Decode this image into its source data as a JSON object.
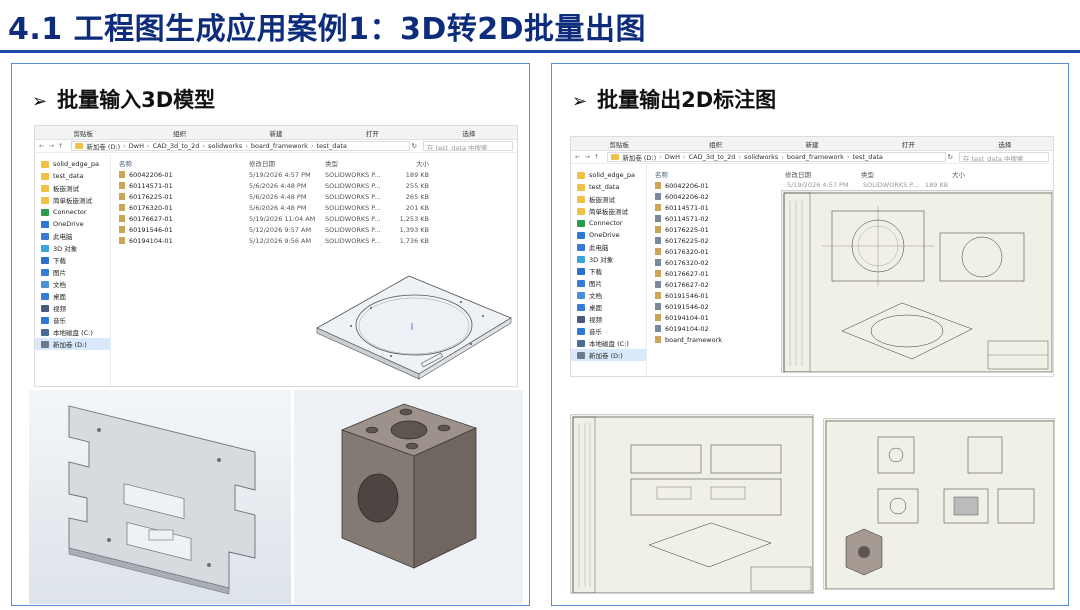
{
  "slide": {
    "title": "4.1 工程图生成应用案例1：3D转2D批量出图"
  },
  "left_panel": {
    "bullet": "➢",
    "heading": "批量输入3D模型",
    "explorer": {
      "ribbon": [
        "剪贴板",
        "组织",
        "新建",
        "打开",
        "选择"
      ],
      "address": [
        "新加卷 (D:)",
        "DwH",
        "CAD_3d_to_2d",
        "solidworks",
        "board_framework",
        "test_data"
      ],
      "search_placeholder": "在 test_data 中搜索",
      "nav_items": [
        "solid_edge_pa",
        "test_data",
        "板嵌测试",
        "简单板嵌测试",
        "Connector",
        "OneDrive",
        "此电脑",
        "3D 对象",
        "下载",
        "图片",
        "文档",
        "桌面",
        "视频",
        "音乐",
        "本地磁盘 (C:)",
        "新加卷 (D:)"
      ],
      "columns": [
        "名称",
        "修改日期",
        "类型",
        "大小"
      ],
      "files": [
        {
          "name": "60042206-01",
          "date": "5/19/2026 4:57 PM",
          "type": "SOLIDWORKS P...",
          "size": "189 KB"
        },
        {
          "name": "60114571-01",
          "date": "5/6/2026 4:48 PM",
          "type": "SOLIDWORKS P...",
          "size": "255 KB"
        },
        {
          "name": "60176225-01",
          "date": "5/6/2026 4:48 PM",
          "type": "SOLIDWORKS P...",
          "size": "265 KB"
        },
        {
          "name": "60176320-01",
          "date": "5/6/2026 4:48 PM",
          "type": "SOLIDWORKS P...",
          "size": "201 KB"
        },
        {
          "name": "60176627-01",
          "date": "5/19/2026 11:04 AM",
          "type": "SOLIDWORKS P...",
          "size": "1,253 KB"
        },
        {
          "name": "60191546-01",
          "date": "5/12/2026 9:57 AM",
          "type": "SOLIDWORKS P...",
          "size": "1,393 KB"
        },
        {
          "name": "60194104-01",
          "date": "5/12/2026 9:56 AM",
          "type": "SOLIDWORKS P...",
          "size": "1,736 KB"
        }
      ]
    }
  },
  "right_panel": {
    "bullet": "➢",
    "heading": "批量输出2D标注图",
    "explorer": {
      "ribbon": [
        "剪贴板",
        "组织",
        "新建",
        "打开",
        "选择"
      ],
      "address": [
        "新加卷 (D:)",
        "DwH",
        "CAD_3d_to_2d",
        "solidworks",
        "board_framework",
        "test_data"
      ],
      "search_placeholder": "在 test_data 中搜索",
      "nav_items": [
        "solid_edge_pa",
        "test_data",
        "板嵌测试",
        "简单板嵌测试",
        "Connector",
        "OneDrive",
        "此电脑",
        "3D 对象",
        "下载",
        "图片",
        "文档",
        "桌面",
        "视频",
        "音乐",
        "本地磁盘 (C:)",
        "新加卷 (D:)"
      ],
      "columns": [
        "名称",
        "修改日期",
        "类型",
        "大小"
      ],
      "first_row": {
        "date": "5/19/2026 4:57 PM",
        "type": "SOLIDWORKS P...",
        "size": "189 KB"
      },
      "files": [
        "60042206-01",
        "60042206-02",
        "60114571-01",
        "60114571-02",
        "60176225-01",
        "60176225-02",
        "60176320-01",
        "60176320-02",
        "60176627-01",
        "60176627-02",
        "60191546-01",
        "60191546-02",
        "60194104-01",
        "60194104-02",
        "board_framework"
      ]
    }
  },
  "colors": {
    "title": "#0d2c7c",
    "rule": "#1e4aa8",
    "panel_border": "#5b8bd0",
    "sheet": "#f1f0e6",
    "cad_bg": "#eaeef3",
    "block": "#8a7f79"
  }
}
